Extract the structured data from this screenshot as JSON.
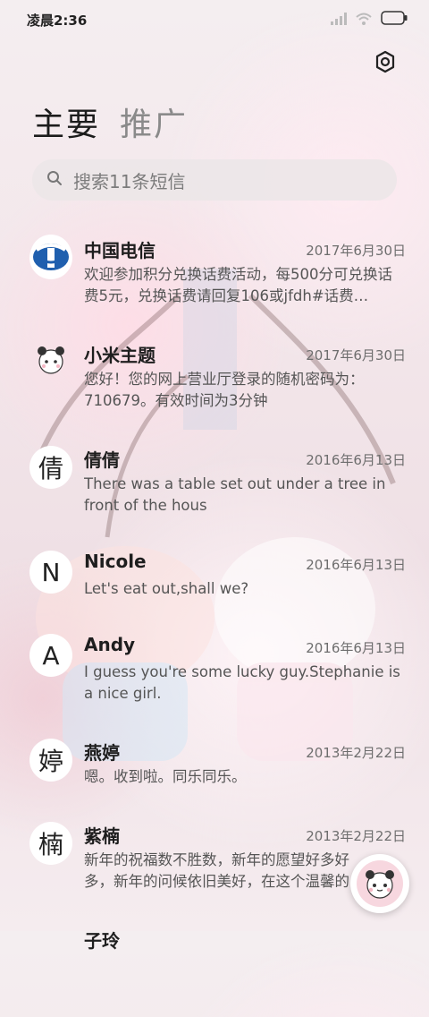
{
  "status_bar": {
    "time": "凌晨2:36"
  },
  "header": {
    "tabs": [
      {
        "label": "主要",
        "active": true
      },
      {
        "label": "推广",
        "active": false
      }
    ]
  },
  "search": {
    "placeholder": "搜索11条短信"
  },
  "messages": [
    {
      "name": "中国电信",
      "date": "2017年6月30日",
      "preview": "欢迎参加积分兑换话费活动，每500分可兑换话费5元，兑换话费请回复106或jfdh#话费…",
      "avatar": "telecom-logo"
    },
    {
      "name": "小米主题",
      "date": "2017年6月30日",
      "preview": "您好！您的网上营业厅登录的随机密码为：710679。有效时间为3分钟",
      "avatar": "panda-sticker"
    },
    {
      "name": "倩倩",
      "date": "2016年6月13日",
      "preview": "There was a table set out under a tree in front of the hous",
      "avatar": "倩"
    },
    {
      "name": "Nicole",
      "date": "2016年6月13日",
      "preview": "Let's eat out,shall we?",
      "avatar": "N"
    },
    {
      "name": "Andy",
      "date": "2016年6月13日",
      "preview": "I guess you're some lucky guy.Stephanie is a nice girl.",
      "avatar": "A"
    },
    {
      "name": "燕婷",
      "date": "2013年2月22日",
      "preview": "嗯。收到啦。同乐同乐。",
      "avatar": "婷"
    },
    {
      "name": "紫楠",
      "date": "2013年2月22日",
      "preview": "新年的祝福数不胜数，新年的愿望好多好多，新年的问候依旧美好，在这个温馨的时刻",
      "avatar": "楠"
    },
    {
      "name": "子玲",
      "date": "",
      "preview": "",
      "avatar": ""
    }
  ],
  "colors": {
    "accent": "#1e1e1e",
    "telecom_blue": "#1f5fae"
  }
}
